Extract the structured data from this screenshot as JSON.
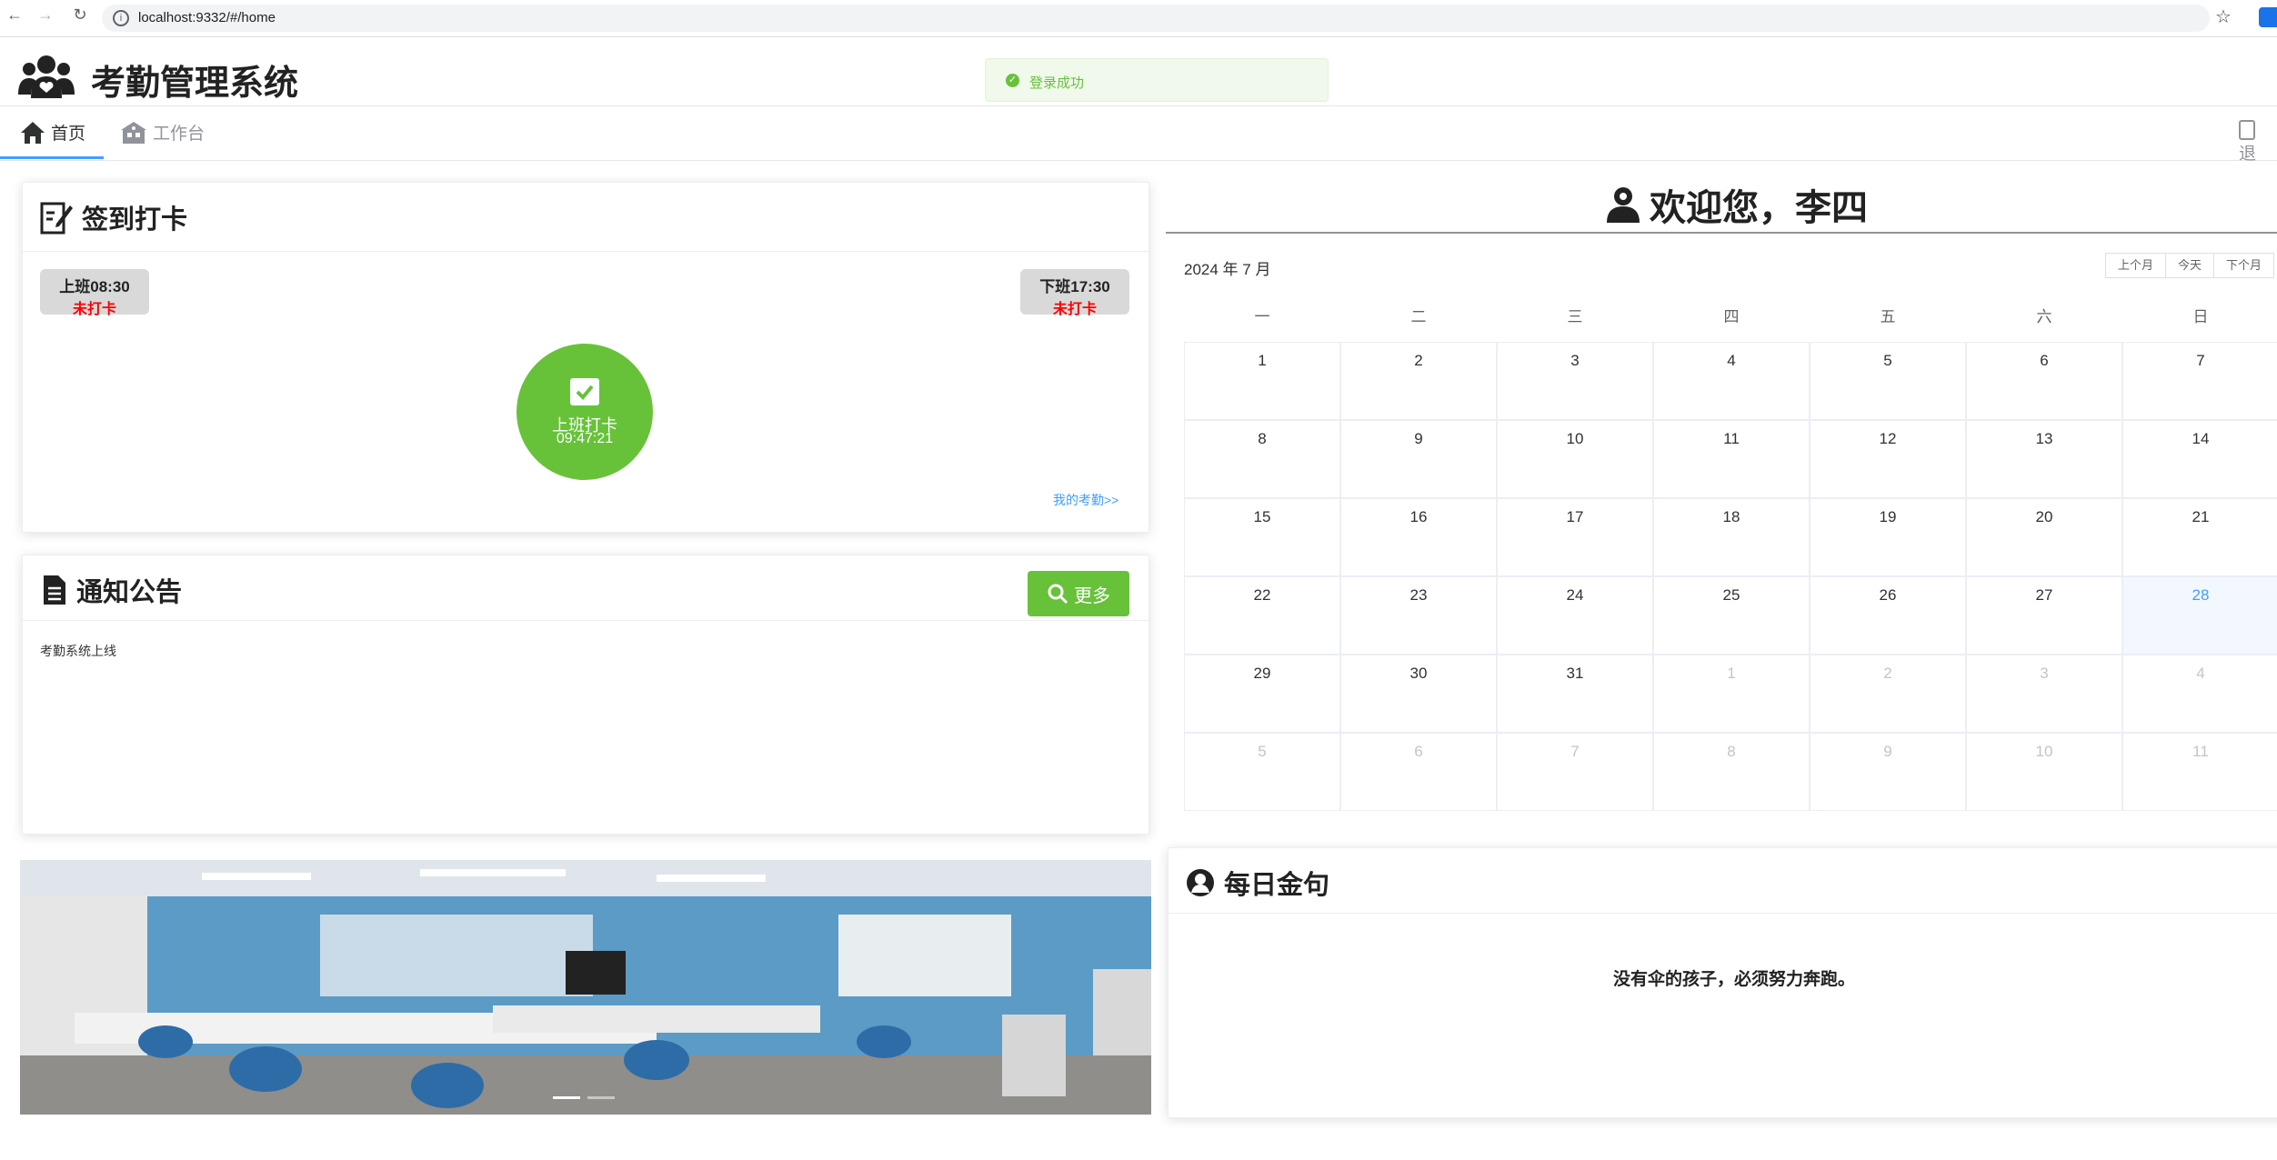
{
  "browser": {
    "url": "localhost:9332/#/home"
  },
  "app": {
    "title": "考勤管理系统"
  },
  "toast": {
    "message": "登录成功"
  },
  "tabs": [
    {
      "label": "首页"
    },
    {
      "label": "工作台"
    }
  ],
  "logout_label": "退",
  "checkin": {
    "title": "签到打卡",
    "start": {
      "label": "上班08:30",
      "status": "未打卡"
    },
    "end": {
      "label": "下班17:30",
      "status": "未打卡"
    },
    "button": {
      "label": "上班打卡",
      "time": "09:47:21"
    },
    "link": "我的考勤>>"
  },
  "notice": {
    "title": "通知公告",
    "more": "更多",
    "items": [
      "考勤系统上线"
    ]
  },
  "welcome": {
    "text": "欢迎您，李四"
  },
  "calendar": {
    "title": "2024 年 7 月",
    "buttons": [
      "上个月",
      "今天",
      "下个月"
    ],
    "weekdays": [
      "一",
      "二",
      "三",
      "四",
      "五",
      "六",
      "日"
    ],
    "weeks": [
      [
        "1",
        "2",
        "3",
        "4",
        "5",
        "6",
        "7"
      ],
      [
        "8",
        "9",
        "10",
        "11",
        "12",
        "13",
        "14"
      ],
      [
        "15",
        "16",
        "17",
        "18",
        "19",
        "20",
        "21"
      ],
      [
        "22",
        "23",
        "24",
        "25",
        "26",
        "27",
        "28"
      ],
      [
        "29",
        "30",
        "31",
        "1",
        "2",
        "3",
        "4"
      ],
      [
        "5",
        "6",
        "7",
        "8",
        "9",
        "10",
        "11"
      ]
    ],
    "today": "28"
  },
  "quote": {
    "title": "每日金句",
    "text": "没有伞的孩子，必须努力奔跑。"
  },
  "colors": {
    "primary": "#409eff",
    "success": "#67c23a",
    "danger": "#ff0000",
    "wall": "#5b9bc6"
  }
}
